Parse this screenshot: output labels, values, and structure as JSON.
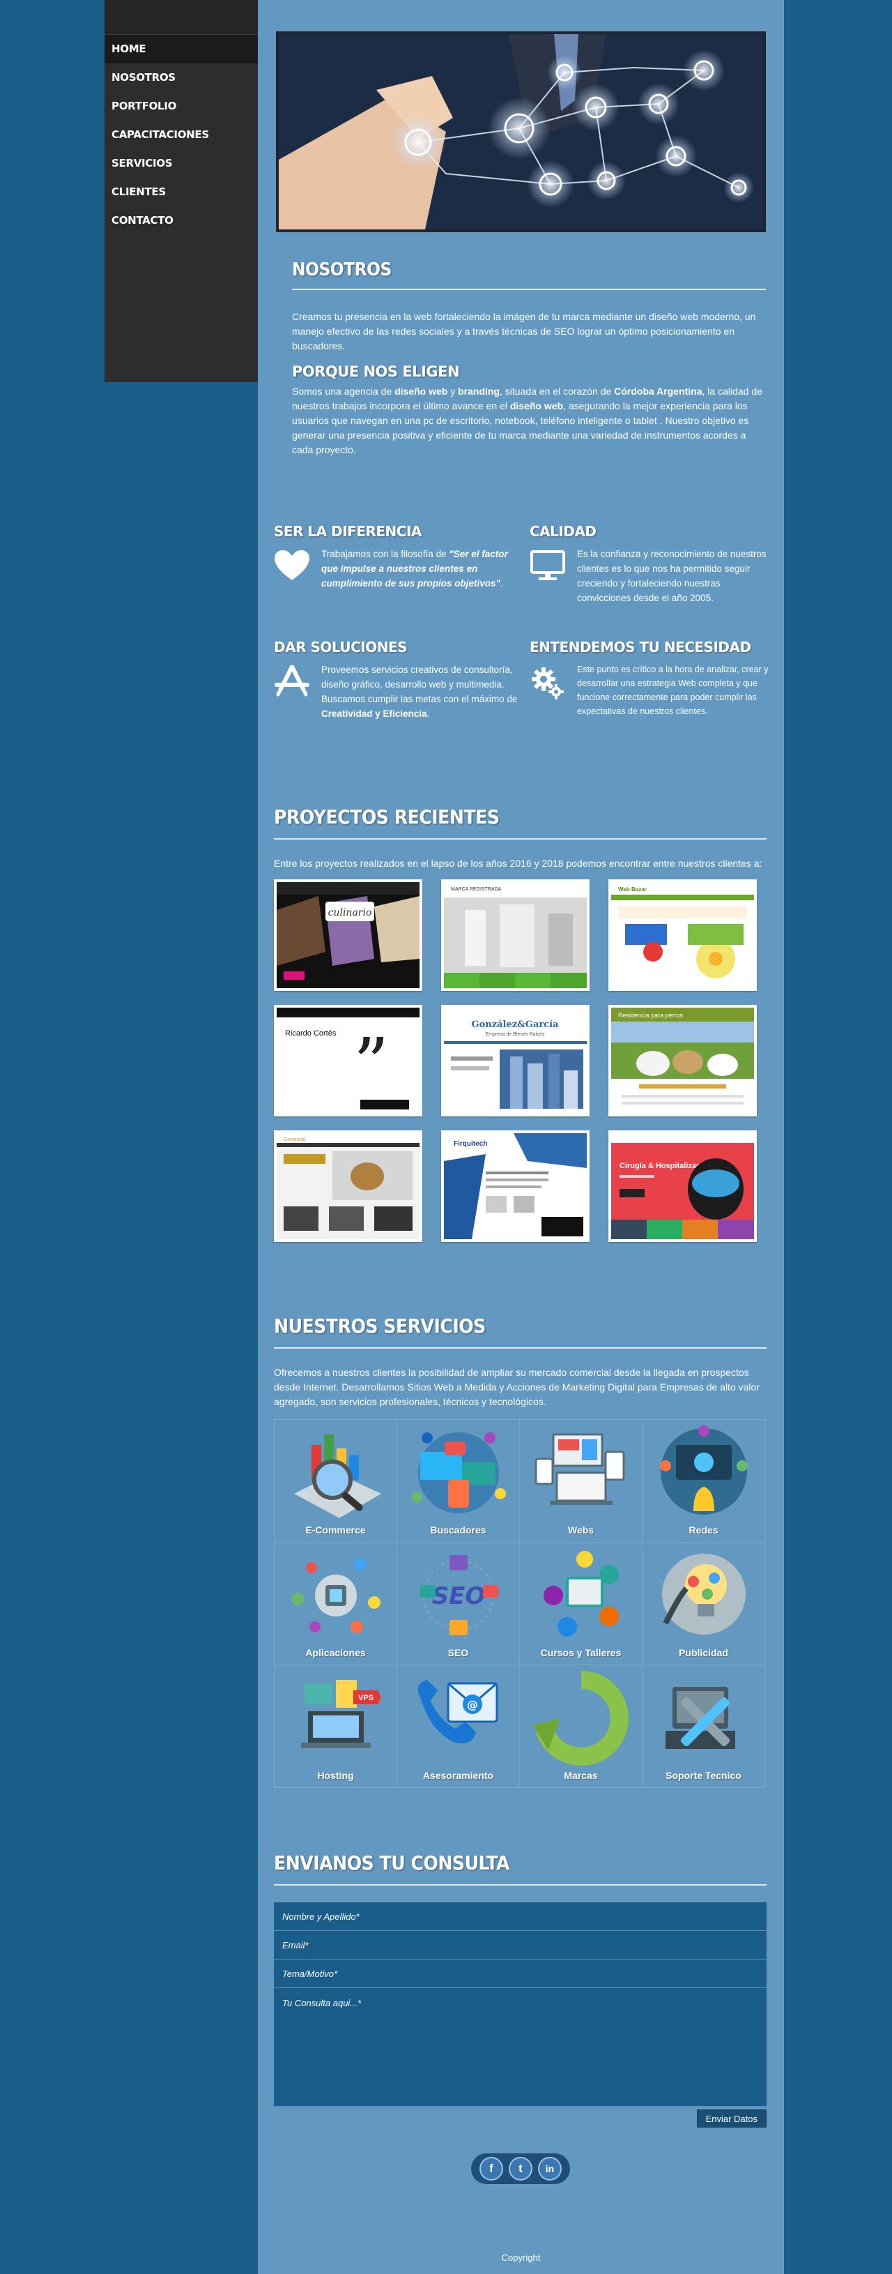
{
  "nav": {
    "items": [
      "HOME",
      "NOSOTROS",
      "PORTFOLIO",
      "CAPACITACIONES",
      "SERVICIOS",
      "CLIENTES",
      "CONTACTO"
    ]
  },
  "nosotros": {
    "title": "NOSOTROS",
    "intro": "Creamos tu presencia en la web fortaleciendo la imágen de tu marca mediante un diseño web moderno, un manejo efectivo de las redes sociales y a través técnicas de SEO lograr un óptimo posicionamiento en buscadores.",
    "subtitle": "PORQUE NOS ELIGEN",
    "why_p1": "Somos una agencia de ",
    "why_b1": "diseño web",
    "why_p2": " y ",
    "why_b2": "branding",
    "why_p3": ", situada en el corazón de ",
    "why_b3": "Córdoba Argentina",
    "why_p4": ", la calidad de nuestros trabajos incorpora el último avance en el ",
    "why_b4": "diseño web",
    "why_p5": ", asegurando la mejor experiencia para los usuarios que navegan en una pc de escritorio, notebook, teléfono inteligente o tablet . Nuestro objetivo es generar una presencia positiva y eficiente de tu marca mediante una variedad de instrumentos acordes a cada proyecto."
  },
  "features": {
    "f1": {
      "title": "SER LA DIFERENCIA",
      "text_a": "Trabajamos con la filosofía de ",
      "text_b": "\"Ser el factor que impulse a nuestros clientes en cumplimiento de sus propios objetivos\"",
      "text_c": "."
    },
    "f2": {
      "title": "CALIDAD",
      "text": "Es la confianza y reconocimiento de nuestros clientes es lo que nos ha permitido seguir creciendo y fortaleciendo nuestras convicciones desde el año 2005."
    },
    "f3": {
      "title": "DAR SOLUCIONES",
      "text_a": "Proveemos servicios creativos de consultoría, diseño gráfico, desarrollo web y multimedia. Buscamos cumplir las metas con el máximo de ",
      "text_b": "Creatividad y Eficiencia",
      "text_c": "."
    },
    "f4": {
      "title": "ENTENDEMOS TU NECESIDAD",
      "text": "Este punto es crítico a la hora de analizar, crear y desarrollar una estrategia Web completa y que funcione correctamente para poder cumplir las expectativas de nuestros clientes."
    }
  },
  "projects": {
    "title": "PROYECTOS RECIENTES",
    "intro": "Entre los proyectos realizados en el lapso de los años 2016 y 2018 podemos encontrar entre nuestros clientes a:",
    "thumbs": [
      {
        "label": "culinario"
      },
      {
        "label": "MARCA REGISTRADA"
      },
      {
        "label": "Web Bazar"
      },
      {
        "label": "Ricardo Cortés"
      },
      {
        "label": "González&García",
        "sub": "Empresa de Bienes Raíces"
      },
      {
        "label": "Residencia para perros"
      },
      {
        "label": "Comercial"
      },
      {
        "label": "Firquitech"
      },
      {
        "label": "Cirugía & Hospitalización"
      }
    ]
  },
  "services": {
    "title": "NUESTROS SERVICIOS",
    "intro": "Ofrecemos a nuestros clientes la posibilidad de ampliar su mercado comercial desde la llegada en prospectos desde Internet. Desarrollamos Sitios Web a Medida y Acciones de Marketing Digital para Empresas de alto valor agregado, son servicios profesionales, técnicos y tecnológicos.",
    "items": [
      "E-Commerce",
      "Buscadores",
      "Webs",
      "Redes",
      "Aplicaciones",
      "SEO",
      "Cursos y Talleres",
      "Publicidad",
      "Hosting",
      "Asesoramiento",
      "Marcas",
      "Soporte Tecnico"
    ],
    "icons": [
      "ecommerce-icon",
      "search-engines-icon",
      "web-devices-icon",
      "networks-icon",
      "apps-icon",
      "seo-icon",
      "courses-icon",
      "advertising-icon",
      "hosting-icon",
      "advisory-icon",
      "brands-icon",
      "support-icon"
    ]
  },
  "contact": {
    "title": "ENVIANOS TU CONSULTA",
    "name_placeholder": "Nombre y Apellido*",
    "email_placeholder": "Email*",
    "topic_placeholder": "Tema/Motivo*",
    "message_placeholder": "Tu Consulta aqui...*",
    "submit_label": "Enviar Datos"
  },
  "social": {
    "facebook": "f",
    "twitter": "t",
    "linkedin": "in"
  },
  "footer": {
    "copyright": "Copyright"
  },
  "colors": {
    "page_bg": "#1b5d8a",
    "content_bg": "#6398c1",
    "sidebar_bg": "#2d2d2d"
  }
}
